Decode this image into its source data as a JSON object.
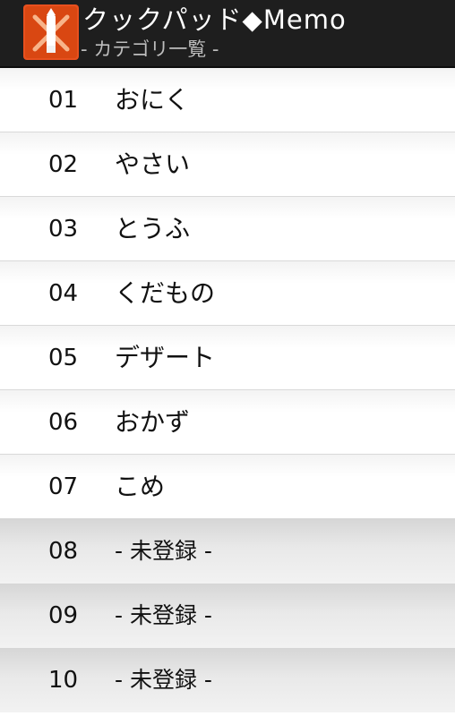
{
  "header": {
    "title": "クックパッド◆Memo",
    "subtitle": "- カテゴリ一覧 -",
    "icon": "cookpad-memo-app-icon",
    "background_color": "#1e1e1e",
    "icon_color": "#e8501e"
  },
  "categories": [
    {
      "number": "01",
      "name": "おにく",
      "registered": true
    },
    {
      "number": "02",
      "name": "やさい",
      "registered": true
    },
    {
      "number": "03",
      "name": "とうふ",
      "registered": true
    },
    {
      "number": "04",
      "name": "くだもの",
      "registered": true
    },
    {
      "number": "05",
      "name": "デザート",
      "registered": true
    },
    {
      "number": "06",
      "name": "おかず",
      "registered": true
    },
    {
      "number": "07",
      "name": "こめ",
      "registered": true
    },
    {
      "number": "08",
      "name": "- 未登録 -",
      "registered": false
    },
    {
      "number": "09",
      "name": "- 未登録 -",
      "registered": false
    },
    {
      "number": "10",
      "name": "- 未登録 -",
      "registered": false
    }
  ]
}
